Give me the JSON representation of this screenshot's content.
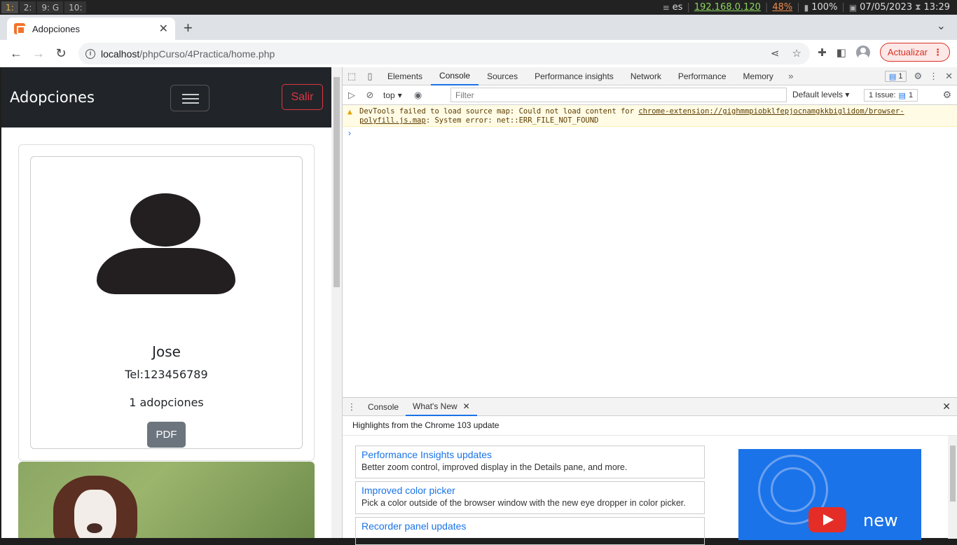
{
  "system": {
    "workspaces": [
      "1:",
      "2:",
      "9: G",
      "10:"
    ],
    "lang": "es",
    "ip": "192.168.0.120",
    "volume": "48%",
    "battery": "100%",
    "date": "07/05/2023",
    "time": "13:29"
  },
  "browser": {
    "tab_title": "Adopciones",
    "url_host": "localhost",
    "url_path": "/phpCurso/4Practica/home.php",
    "update_label": "Actualizar"
  },
  "page": {
    "brand": "Adopciones",
    "logout_label": "Salir",
    "card": {
      "name": "Jose",
      "tel": "Tel:123456789",
      "adoptions": "1 adopciones",
      "pdf_label": "PDF"
    }
  },
  "devtools": {
    "tabs": [
      "Elements",
      "Console",
      "Sources",
      "Performance insights",
      "Network",
      "Performance",
      "Memory"
    ],
    "active_tab": "Console",
    "message_count": "1",
    "context": "top",
    "filter_placeholder": "Filter",
    "levels": "Default levels",
    "issues_label": "1 Issue:",
    "issues_count": "1",
    "warning": {
      "text_before": "DevTools failed to load source map: Could not load content for ",
      "link": "chrome-extension://gighmmpiobklfepjocnamgkkbiglidom/browser-polyfill.js.map",
      "text_after": ": System error: net::ERR_FILE_NOT_FOUND"
    },
    "drawer": {
      "tabs": [
        "Console",
        "What's New"
      ],
      "heading": "Highlights from the Chrome 103 update",
      "items": [
        {
          "title": "Performance Insights updates",
          "desc": "Better zoom control, improved display in the Details pane, and more."
        },
        {
          "title": "Improved color picker",
          "desc": "Pick a color outside of the browser window with the new eye dropper in color picker."
        },
        {
          "title": "Recorder panel updates",
          "desc": ""
        }
      ],
      "video_text": "new"
    }
  },
  "colors": {
    "navbar_bg": "#212529",
    "danger": "#dc3545",
    "secondary": "#6c757d",
    "devtools_accent": "#1a73e8"
  }
}
